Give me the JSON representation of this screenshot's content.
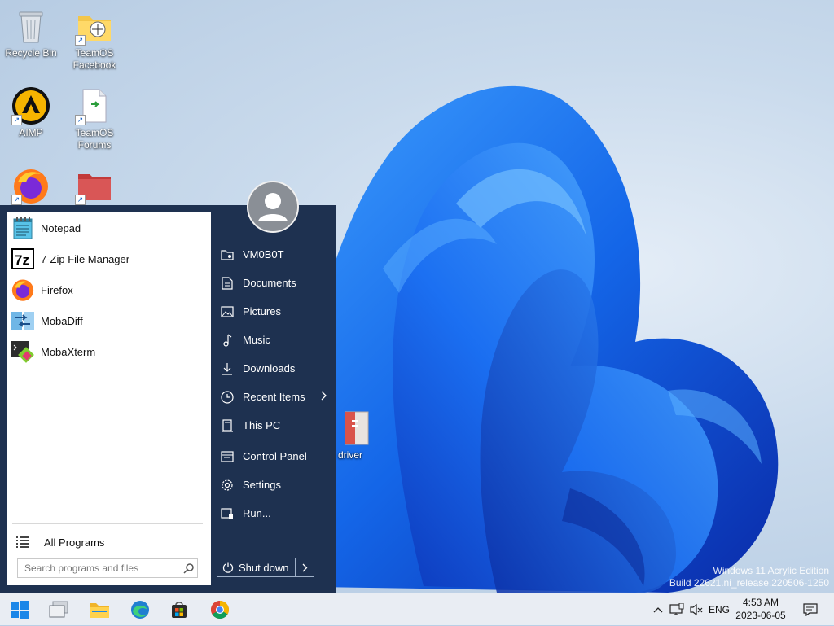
{
  "desktop": {
    "icons": [
      {
        "label": "Recycle Bin"
      },
      {
        "label": "TeamOS\nFacebook"
      },
      {
        "label": "AIMP"
      },
      {
        "label": "TeamOS\nForums"
      },
      {
        "label": ""
      },
      {
        "label": ""
      },
      {
        "label": "driver"
      }
    ],
    "watermark": {
      "line1": "Windows 11 Acrylic Edition",
      "line2": "Build 22621.ni_release.220506-1250"
    }
  },
  "start_menu": {
    "pinned": [
      {
        "label": "Notepad",
        "icon": "notepad-icon"
      },
      {
        "label": "7-Zip File Manager",
        "icon": "7zip-icon"
      },
      {
        "label": "Firefox",
        "icon": "firefox-icon"
      },
      {
        "label": "MobaDiff",
        "icon": "mobadiff-icon"
      },
      {
        "label": "MobaXterm",
        "icon": "mobaxterm-icon"
      }
    ],
    "all_programs": "All Programs",
    "search_placeholder": "Search programs and files",
    "right": [
      {
        "label": "VM0B0T",
        "icon": "user-folder-icon"
      },
      {
        "label": "Documents",
        "icon": "document-icon"
      },
      {
        "label": "Pictures",
        "icon": "picture-icon"
      },
      {
        "label": "Music",
        "icon": "music-icon"
      },
      {
        "label": "Downloads",
        "icon": "download-icon"
      },
      {
        "label": "Recent Items",
        "icon": "clock-icon"
      },
      {
        "label": "This PC",
        "icon": "computer-icon"
      },
      {
        "label": "Control Panel",
        "icon": "control-panel-icon"
      },
      {
        "label": "Settings",
        "icon": "gear-icon"
      },
      {
        "label": "Run...",
        "icon": "run-icon"
      }
    ],
    "shutdown": "Shut down"
  },
  "taskbar": {
    "apps": [
      "start-icon",
      "task-view-icon",
      "file-explorer-icon",
      "edge-icon",
      "store-icon",
      "chrome-icon"
    ],
    "tray": {
      "language": "ENG",
      "time": "4:53 AM",
      "date": "2023-06-05"
    }
  },
  "colors": {
    "menu_bg": "#1e3150",
    "accent": "#1a62c6",
    "taskbar": "#e9edf3"
  }
}
